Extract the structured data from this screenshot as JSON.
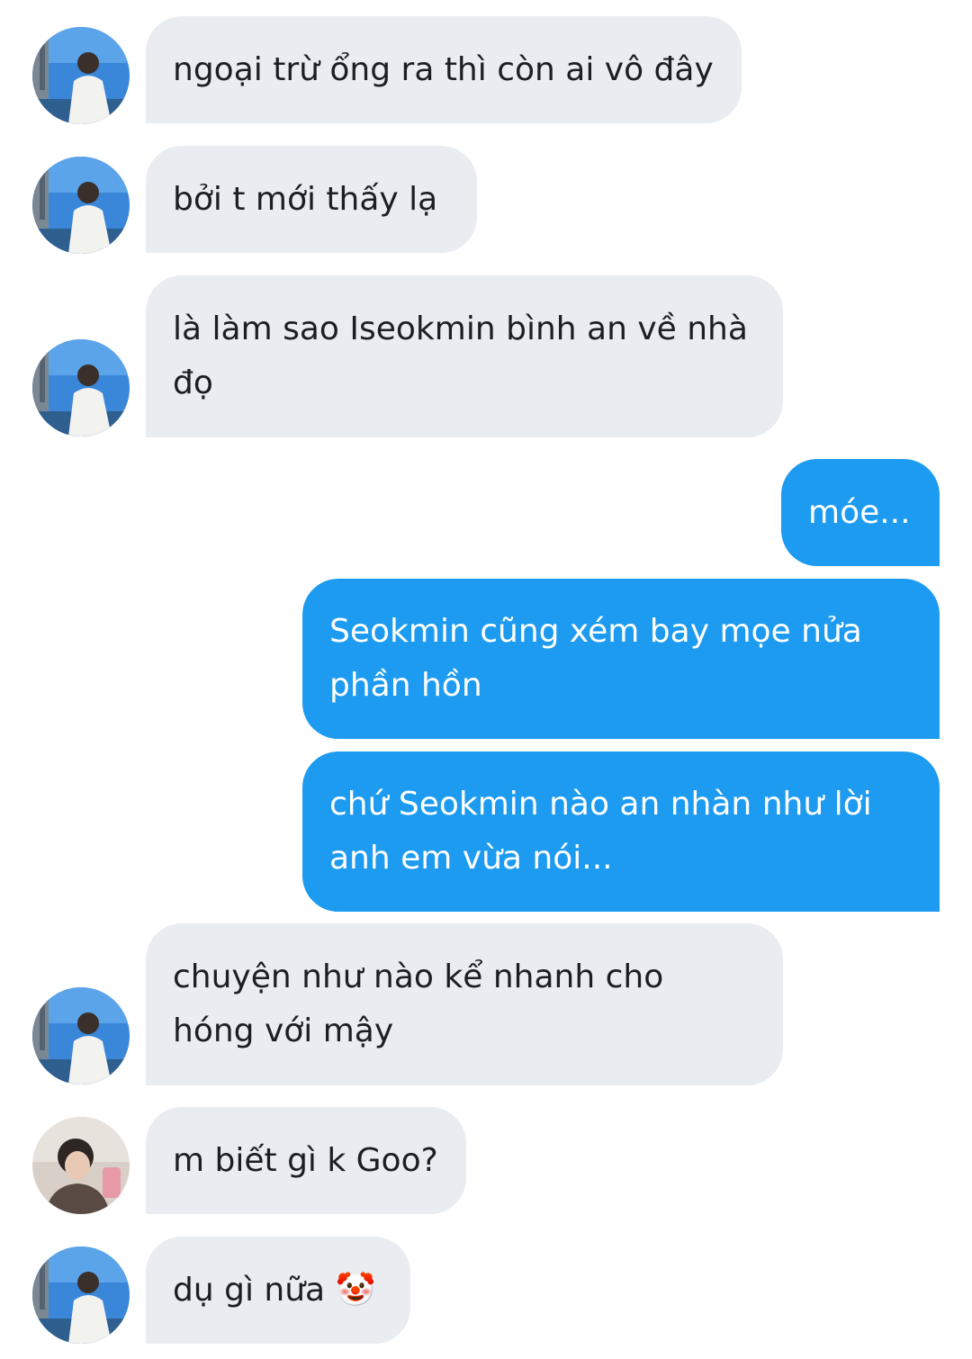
{
  "messages": [
    {
      "direction": "incoming",
      "sender_avatar": "friend-avatar",
      "text": "ngoại trừ ổng ra thì còn ai vô đây"
    },
    {
      "direction": "incoming",
      "sender_avatar": "friend-avatar",
      "text": "bởi t mới thấy lạ"
    },
    {
      "direction": "incoming",
      "sender_avatar": "friend-avatar",
      "text": "là làm sao Iseokmin bình an về nhà\nđọ"
    },
    {
      "direction": "outgoing",
      "text": "móe..."
    },
    {
      "direction": "outgoing",
      "text": "Seokmin cũng xém bay mọe nửa\nphần hồn"
    },
    {
      "direction": "outgoing",
      "text": "chứ Seokmin nào an nhàn như lời\nanh em vừa nói..."
    },
    {
      "direction": "incoming",
      "sender_avatar": "friend-avatar",
      "text": "chuyện như nào kể nhanh cho\nhóng với mậy"
    },
    {
      "direction": "incoming",
      "sender_avatar": "second-friend-avatar",
      "text": "m biết gì k Goo?"
    },
    {
      "direction": "incoming",
      "sender_avatar": "friend-avatar",
      "text": "dụ gì nữa 🤡"
    }
  ],
  "colors": {
    "incoming_bubble": "#e9ecf0",
    "outgoing_bubble": "#1d9bf0",
    "incoming_text": "#1b1e22",
    "outgoing_text": "#ffffff"
  }
}
